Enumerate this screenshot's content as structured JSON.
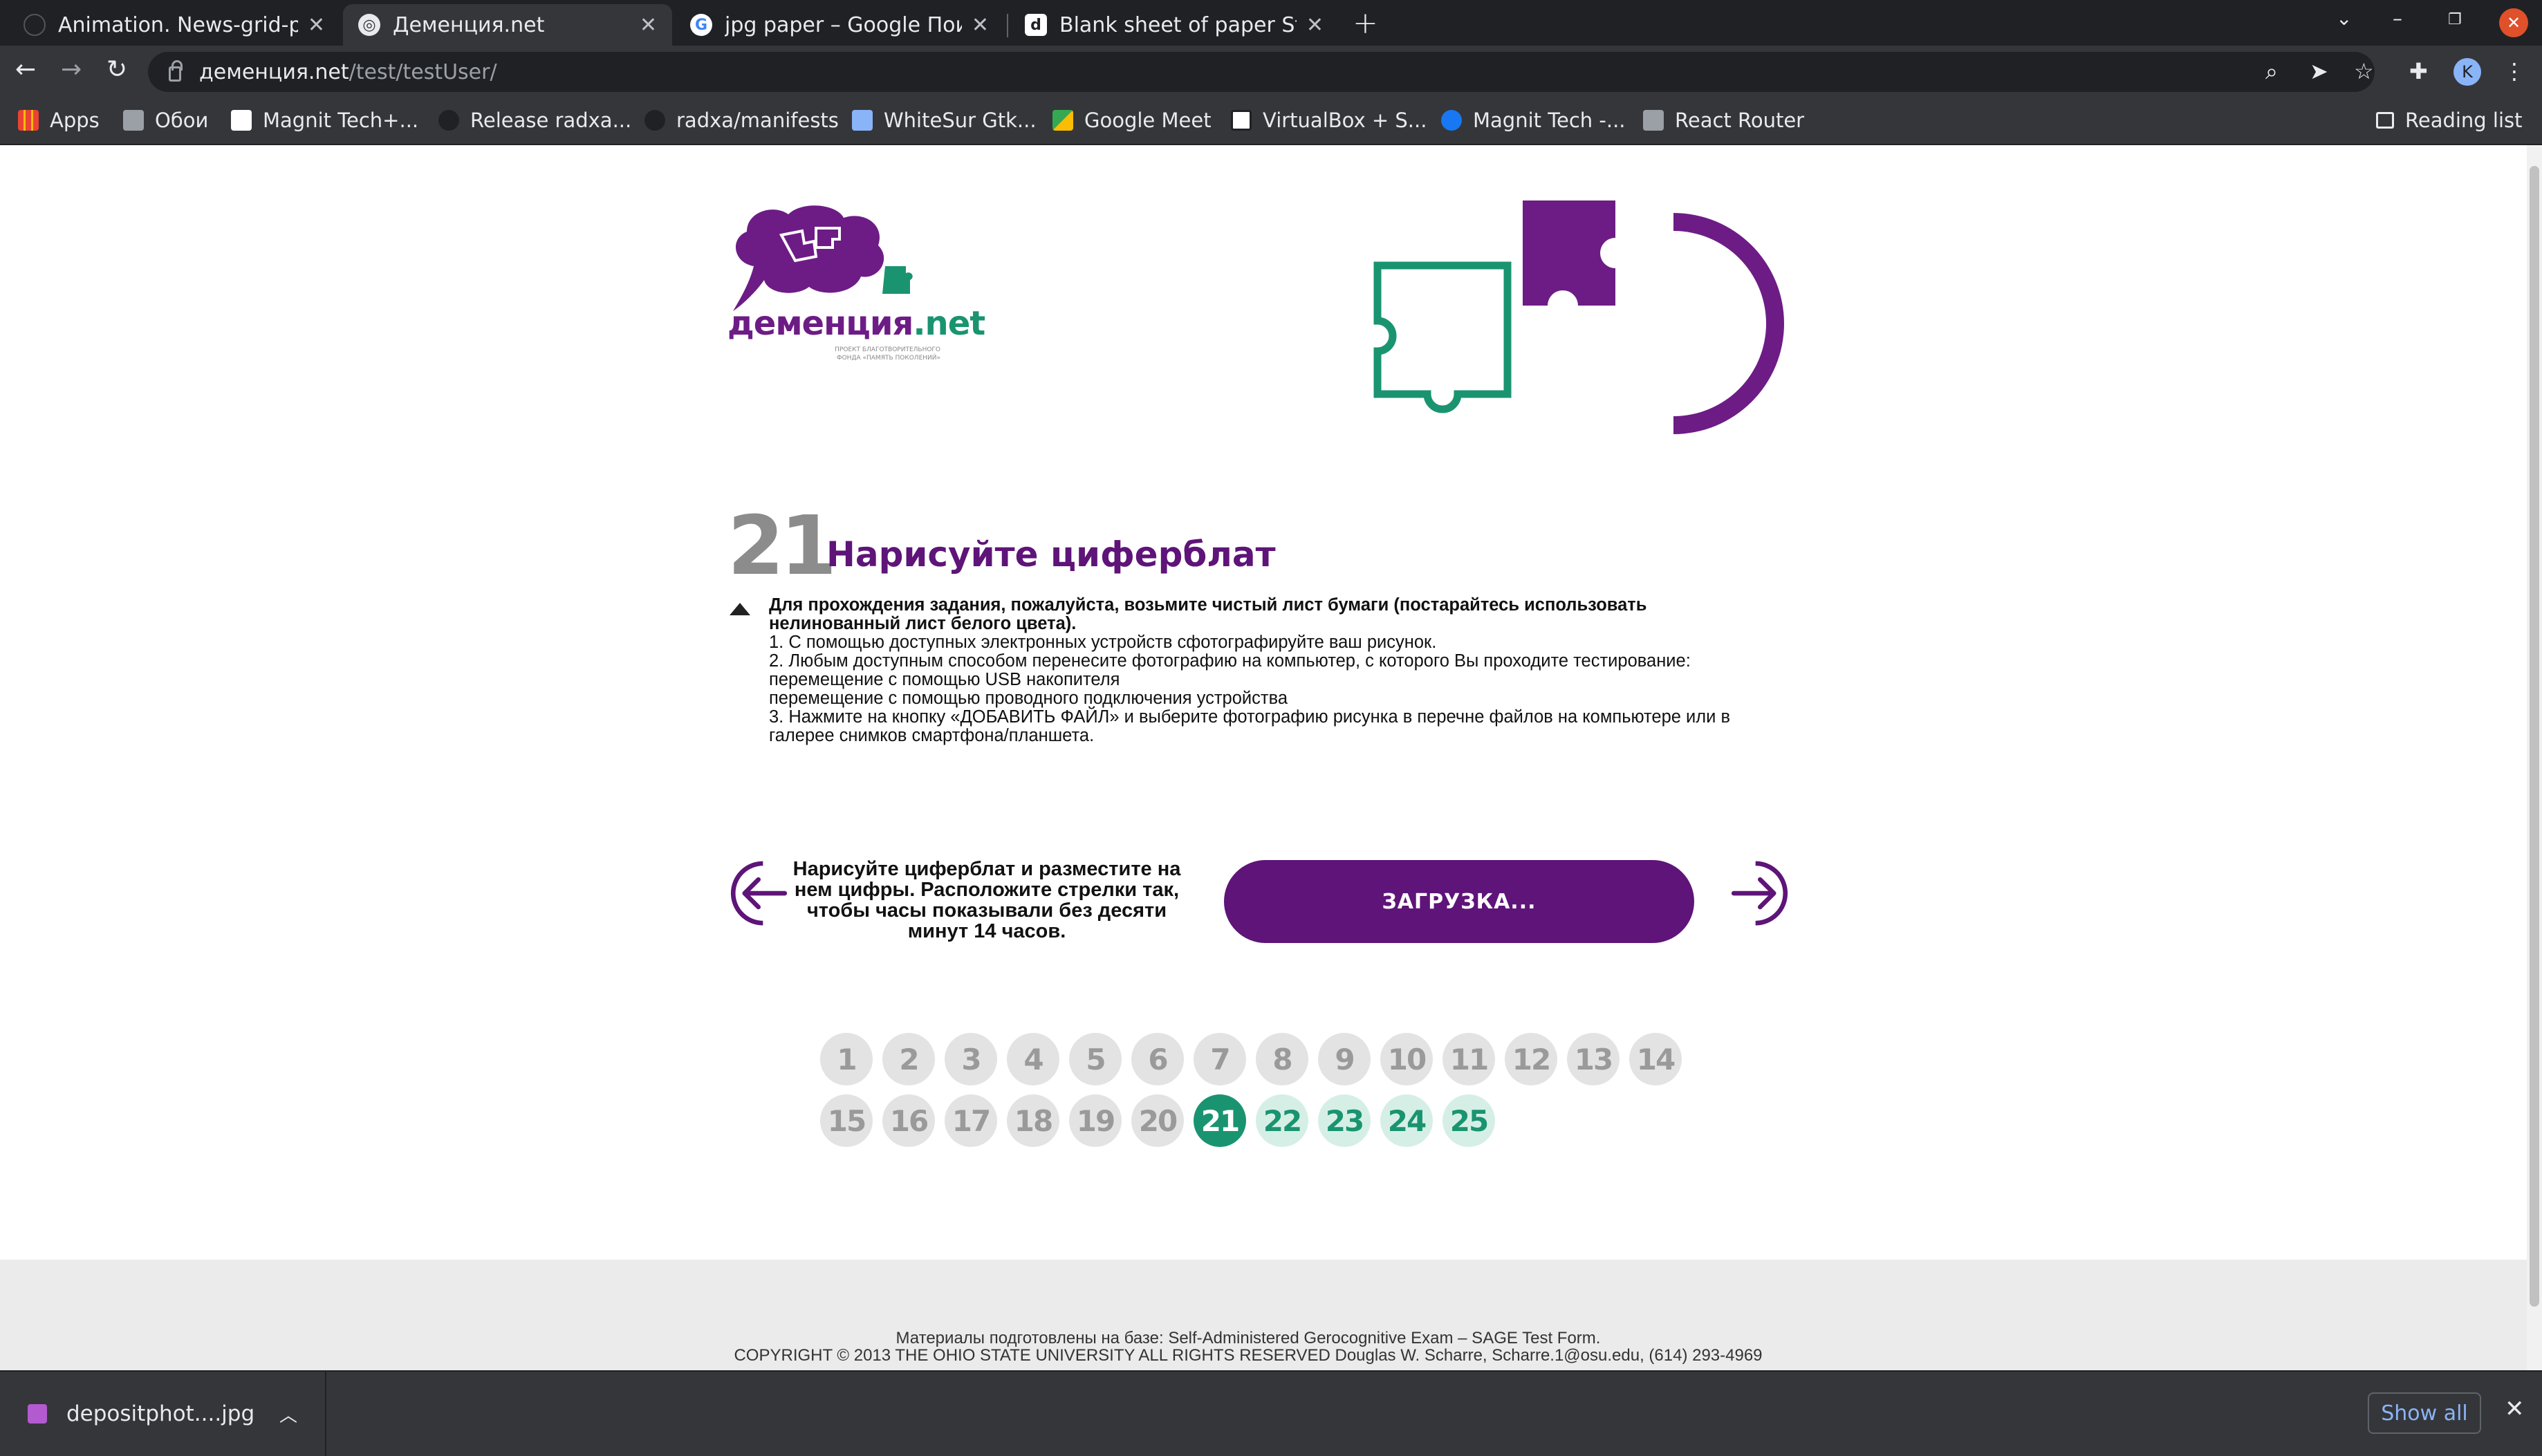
{
  "browser": {
    "tabs": [
      {
        "title": "Animation. News-grid-pag"
      },
      {
        "title": "Деменция.net"
      },
      {
        "title": "jpg paper – Google Поиск"
      },
      {
        "title": "Blank sheet of paper Stoc"
      }
    ],
    "url_host": "деменция.net",
    "url_path": "/test/testUser/",
    "profile_initial": "K",
    "bookmarks": [
      {
        "label": "Apps"
      },
      {
        "label": "Обои"
      },
      {
        "label": "Magnit Tech+..."
      },
      {
        "label": "Release radxa..."
      },
      {
        "label": "radxa/manifests"
      },
      {
        "label": "WhiteSur Gtk..."
      },
      {
        "label": "Google Meet"
      },
      {
        "label": "VirtualBox + S..."
      },
      {
        "label": "Magnit Tech -..."
      },
      {
        "label": "React Router"
      }
    ],
    "reading_list": "Reading list"
  },
  "page": {
    "logo": {
      "main": "деменция",
      "suffix": ".net",
      "subtitle": "ПРОЕКТ БЛАГОТВОРИТЕЛЬНОГО ФОНДА «ПАМЯТЬ ПОКОЛЕНИЙ»"
    },
    "question_number": "21",
    "question_title": "Нарисуйте циферблат",
    "instructions": {
      "intro": "Для прохождения задания, пожалуйста, возьмите чистый лист бумаги (постарайтесь использовать нелинованный лист белого цвета).",
      "lines": [
        "1. С помощью доступных электронных устройств сфотографируйте ваш рисунок.",
        "2. Любым доступным способом перенесите фотографию на компьютер, с которого Вы проходите тестирование:",
        "перемещение с помощью USB накопителя",
        "перемещение с помощью проводного подключения устройства",
        "3. Нажмите на кнопку «ДОБАВИТЬ ФАЙЛ» и выберите фотографию рисунка в перечне файлов на компьютере или в галерее снимков смартфона/планшета."
      ]
    },
    "task_text": "Нарисуйте циферблат и разместите на нем цифры. Расположите стрелки так, чтобы часы показывали без десяти минут 14 часов.",
    "upload_label": "ЗАГРУЗКА...",
    "pages": [
      "1",
      "2",
      "3",
      "4",
      "5",
      "6",
      "7",
      "8",
      "9",
      "10",
      "11",
      "12",
      "13",
      "14",
      "15",
      "16",
      "17",
      "18",
      "19",
      "20",
      "21",
      "22",
      "23",
      "24",
      "25"
    ],
    "current_page": "21",
    "footer_line1": "Материалы подготовлены на базе: Self-Administered Gerocognitive Exam – SAGE Test Form.",
    "footer_line2": "COPYRIGHT © 2013 THE OHIO STATE UNIVERSITY ALL RIGHTS RESERVED Douglas W. Scharre, Scharre.1@osu.edu, (614) 293-4969"
  },
  "downloads": {
    "file_name": "depositphot....jpg",
    "show_all": "Show all"
  },
  "colors": {
    "brand_purple": "#5e1478",
    "brand_green": "#1a9470",
    "chrome_dark": "#202124",
    "chrome_mid": "#35363a"
  }
}
